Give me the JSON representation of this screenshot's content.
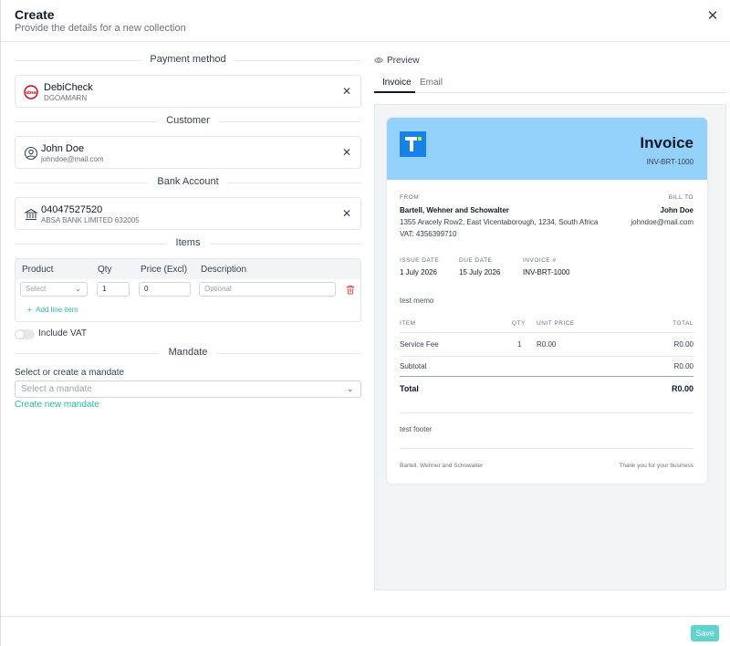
{
  "header": {
    "title": "Create",
    "subtitle": "Provide the details for a new collection"
  },
  "payment_method": {
    "section_label": "Payment method",
    "name": "DebiCheck",
    "code": "DGOAMARN",
    "icon": "absa-logo-icon",
    "logo_text": "absa"
  },
  "customer": {
    "section_label": "Customer",
    "name": "John Doe",
    "email": "johndoe@mail.com"
  },
  "bank_account": {
    "section_label": "Bank Account",
    "number": "04047527520",
    "bank": "ABSA BANK LIMITED 632005"
  },
  "items": {
    "section_label": "Items",
    "columns": [
      "Product",
      "Qty",
      "Price (Excl)",
      "Description"
    ],
    "row": {
      "product_placeholder": "Select",
      "qty": "1",
      "price": "0",
      "description_placeholder": "Optional"
    },
    "add_line_label": "Add line item"
  },
  "vat": {
    "label": "Include VAT",
    "enabled": false
  },
  "mandate": {
    "section_label": "Mandate",
    "field_label": "Select or create a mandate",
    "placeholder": "Select a mandate",
    "create_link": "Create new mandate"
  },
  "preview": {
    "label": "Preview",
    "tabs": [
      "Invoice",
      "Email"
    ],
    "active_tab": "Invoice"
  },
  "invoice": {
    "title": "Invoice",
    "number": "INV-BRT-1000",
    "from_label": "FROM",
    "from_name": "Bartell, Wehner and Schowalter",
    "from_address": "1355 Aracely Row2, East Vicentaborough, 1234, South Africa",
    "from_vat": "VAT: 4356399710",
    "bill_to_label": "BILL TO",
    "bill_to_name": "John Doe",
    "bill_to_email": "johndoe@mail.com",
    "issue_date_label": "ISSUE DATE",
    "issue_date": "1 July 2026",
    "due_date_label": "DUE DATE",
    "due_date": "15 July 2026",
    "invoice_no_label": "INVOICE #",
    "invoice_no": "INV-BRT-1000",
    "memo": "test memo",
    "table_headers": {
      "item": "ITEM",
      "qty": "QTY",
      "unit_price": "UNIT PRICE",
      "total": "TOTAL"
    },
    "line_items": [
      {
        "item": "Service Fee",
        "qty": "1",
        "unit_price": "R0.00",
        "total": "R0.00"
      }
    ],
    "subtotal_label": "Subtotal",
    "subtotal": "R0.00",
    "total_label": "Total",
    "total": "R0.00",
    "footer_note": "test footer",
    "footer_company": "Bartell, Wehner and Schowalter",
    "footer_thanks": "Thank you for your business"
  },
  "actions": {
    "save": "Save"
  },
  "colors": {
    "accent": "#2bb9a6",
    "invoice_header": "#93d0fa",
    "logo": "#1681e6",
    "save_button": "#5fd3cc"
  }
}
